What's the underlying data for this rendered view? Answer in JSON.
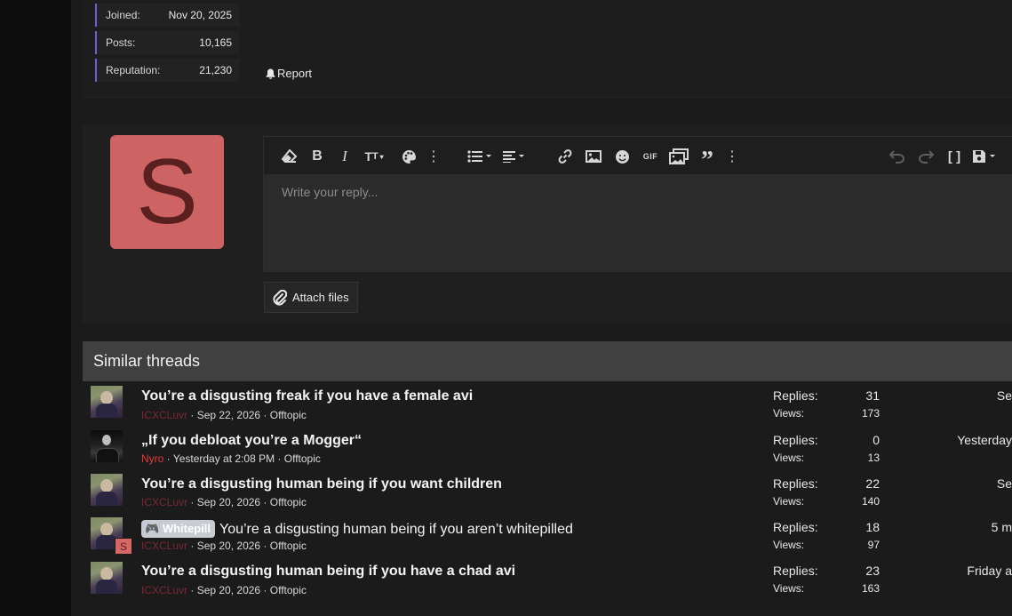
{
  "user_stats": [
    {
      "label": "Joined:",
      "value": "Nov 20, 2025"
    },
    {
      "label": "Posts:",
      "value": "10,165"
    },
    {
      "label": "Reputation:",
      "value": "21,230"
    }
  ],
  "post_actions": {
    "report_label": "Report"
  },
  "reply": {
    "avatar_letter": "S",
    "avatar_color": "#cd6363",
    "placeholder": "Write your reply...",
    "attach_label": "Attach files",
    "toolbar_icons": [
      "eraser-icon",
      "bold-icon",
      "italic-icon",
      "text-size-icon",
      "palette-icon",
      "more-vertical-icon",
      "list-icon",
      "align-icon",
      "link-icon",
      "image-icon",
      "emoji-icon",
      "gif-icon",
      "media-icon",
      "quote-icon",
      "more-vertical-icon",
      "undo-icon",
      "redo-icon",
      "bbcode-icon",
      "save-draft-icon"
    ]
  },
  "similar": {
    "heading": "Similar threads",
    "replies_label": "Replies:",
    "views_label": "Views:",
    "threads": [
      {
        "title": "You’re a disgusting freak if you have a female avi",
        "author": "ICXCLuvr",
        "date": "Sep 22, 2026",
        "forum": "Offtopic",
        "replies": "31",
        "views": "173",
        "last": "Se",
        "prefix": ""
      },
      {
        "title": "„If you debloat you’re a Mogger“",
        "author": "Nyro",
        "date": "Yesterday at 2:08 PM",
        "forum": "Offtopic",
        "replies": "0",
        "views": "13",
        "last": "Yesterday",
        "prefix": ""
      },
      {
        "title": "You’re a disgusting human being if you want children",
        "author": "ICXCLuvr",
        "date": "Sep 20, 2026",
        "forum": "Offtopic",
        "replies": "22",
        "views": "140",
        "last": "Se",
        "prefix": ""
      },
      {
        "title": "You’re a disgusting human being if you aren’t whitepilled",
        "author": "ICXCLuvr",
        "date": "Sep 20, 2026",
        "forum": "Offtopic",
        "replies": "18",
        "views": "97",
        "last": "5 m",
        "prefix": "Whitepill",
        "badge": "S"
      },
      {
        "title": "You’re a disgusting human being if you have a chad avi",
        "author": "ICXCLuvr",
        "date": "Sep 20, 2026",
        "forum": "Offtopic",
        "replies": "23",
        "views": "163",
        "last": "Friday a",
        "prefix": ""
      }
    ]
  }
}
